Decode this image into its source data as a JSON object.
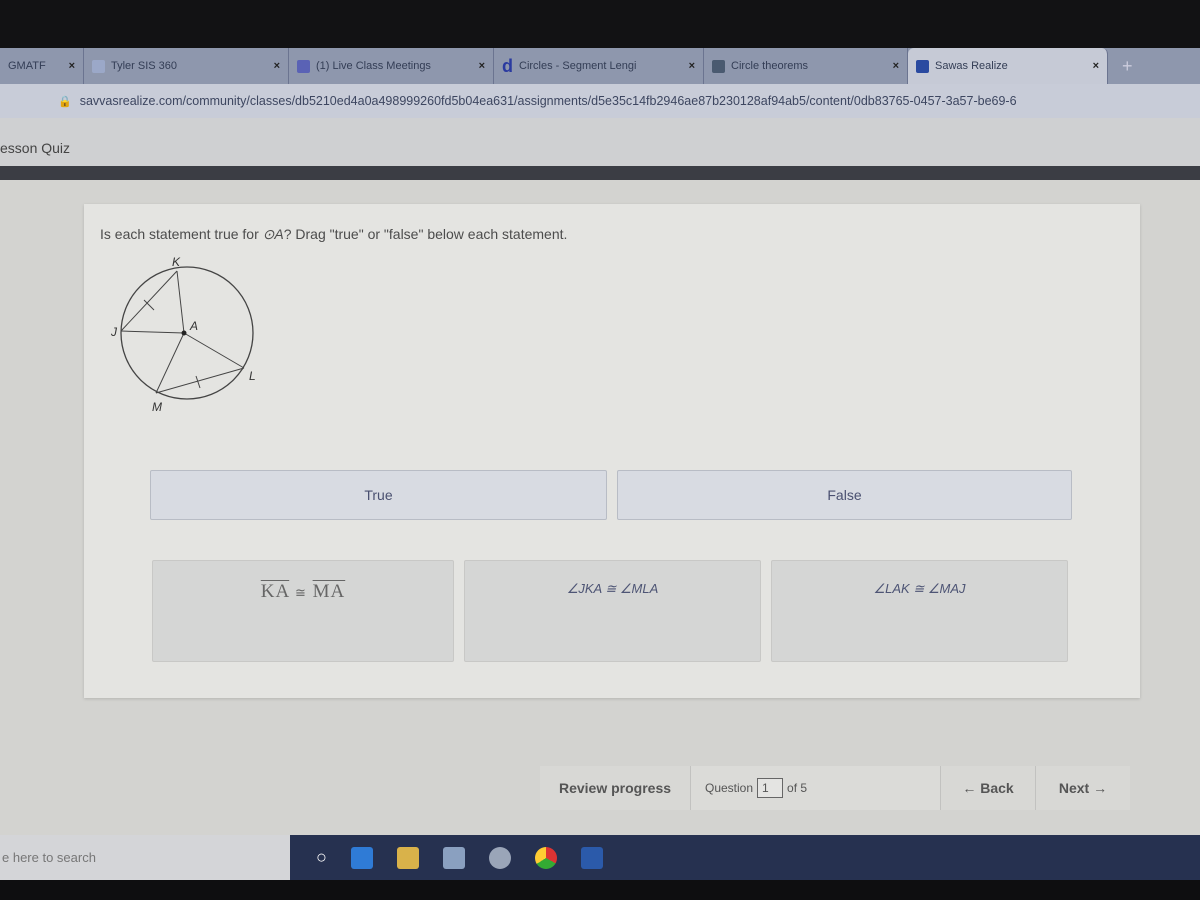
{
  "browser": {
    "tabs": [
      {
        "title": "GMATF",
        "active": false
      },
      {
        "title": "Tyler SIS 360",
        "active": false
      },
      {
        "title": "(1) Live Class Meetings",
        "active": false
      },
      {
        "title": "Circles - Segment Lengi",
        "active": false
      },
      {
        "title": "Circle theorems",
        "active": false
      },
      {
        "title": "Sawas Realize",
        "active": true
      }
    ],
    "new_tab": "+",
    "url": "savvasrealize.com/community/classes/db5210ed4a0a498999260fd5b04ea631/assignments/d5e35c14fb2946ae87b230128af94ab5/content/0db83765-0457-3a57-be69-6"
  },
  "page": {
    "title": "esson Quiz",
    "prompt_pre": "Is each statement true for ",
    "prompt_circle": "⊙A",
    "prompt_post": "? Drag \"true\" or \"false\" below each statement.",
    "diagram_labels": {
      "K": "K",
      "J": "J",
      "A": "A",
      "L": "L",
      "M": "M"
    },
    "answers": {
      "true_label": "True",
      "false_label": "False"
    },
    "statements": [
      {
        "text_left": "KA",
        "rel": "≅",
        "text_right": "MA"
      },
      {
        "text": "∠JKA ≅ ∠MLA"
      },
      {
        "text": "∠LAK ≅ ∠MAJ"
      }
    ]
  },
  "footer": {
    "review": "Review progress",
    "question_label": "Question",
    "question_value": "1",
    "of_label": "of 5",
    "back": "← Back",
    "next": "Next →"
  },
  "taskbar": {
    "search_placeholder": "e here to search"
  }
}
